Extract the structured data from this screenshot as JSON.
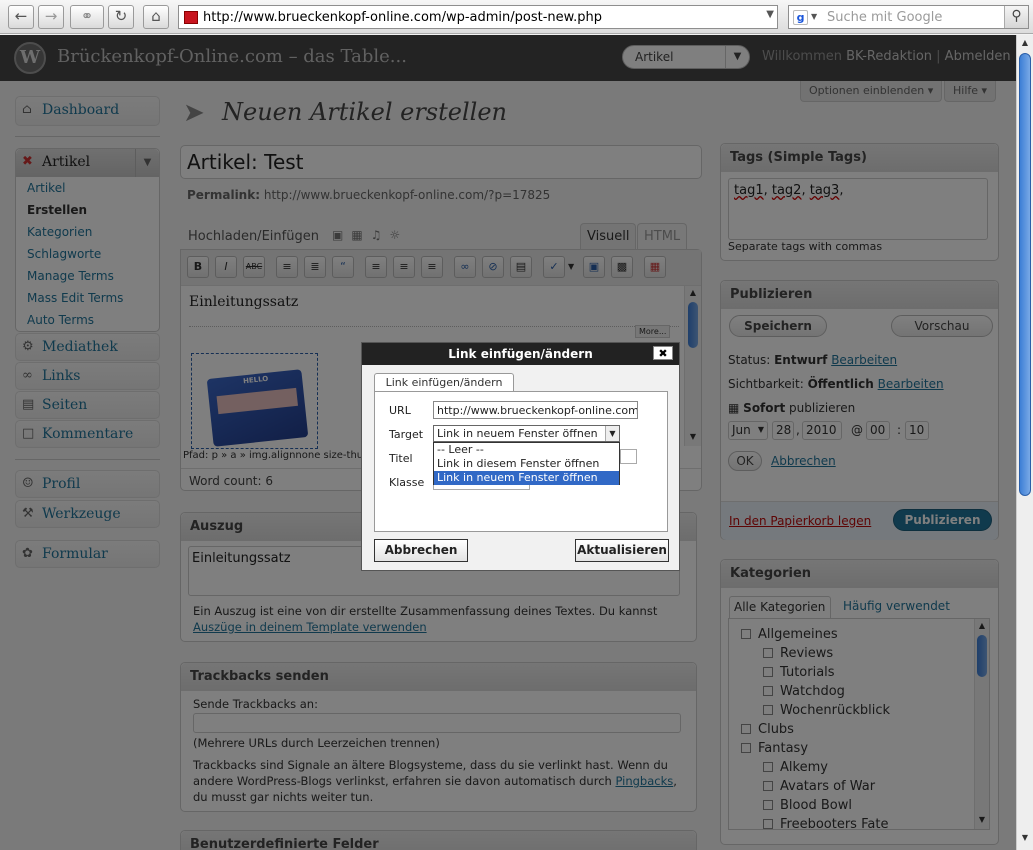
{
  "browser": {
    "url": "http://www.brueckenkopf-online.com/wp-admin/post-new.php",
    "search_placeholder": "Suche mit Google"
  },
  "header": {
    "site_title": "Brückenkopf-Online.com – das Table...",
    "favorites_selected": "Artikel",
    "welcome": "Willkommen",
    "username": "BK-Redaktion",
    "logout": "Abmelden"
  },
  "screen_options": {
    "options": "Optionen einblenden",
    "help": "Hilfe"
  },
  "sidebar": {
    "dashboard": "Dashboard",
    "artikel": "Artikel",
    "artikel_items": [
      "Artikel",
      "Erstellen",
      "Kategorien",
      "Schlagworte",
      "Manage Terms",
      "Mass Edit Terms",
      "Auto Terms"
    ],
    "mediathek": "Mediathek",
    "links": "Links",
    "seiten": "Seiten",
    "kommentare": "Kommentare",
    "profil": "Profil",
    "werkzeuge": "Werkzeuge",
    "formular": "Formular"
  },
  "main": {
    "page_title": "Neuen Artikel erstellen",
    "post_title": "Artikel: Test",
    "permalink_label": "Permalink:",
    "permalink_url": "http://www.brueckenkopf-online.com/?p=17825",
    "upload_label": "Hochladen/Einfügen",
    "tab_visual": "Visuell",
    "tab_html": "HTML",
    "editor_text": "Einleitungssatz",
    "more_tag": "More...",
    "image_text": "HELLO",
    "path": "Pfad: p » a » img.alignnone size-thumb",
    "word_count": "Word count: 6"
  },
  "excerpt": {
    "title": "Auszug",
    "value": "Einleitungssatz",
    "desc": "Ein Auszug ist eine von dir erstellte Zusammenfassung deines Textes. Du kannst",
    "link": "Auszüge in deinem Template verwenden"
  },
  "trackbacks": {
    "title": "Trackbacks senden",
    "label": "Sende Trackbacks an:",
    "hint": "(Mehrere URLs durch Leerzeichen trennen)",
    "desc1": "Trackbacks sind Signale an ältere Blogsysteme, dass du sie verlinkt hast. Wenn du",
    "desc2": "andere WordPress-Blogs verlinkst, erfahren sie davon automatisch durch",
    "pingbacks": "Pingbacks",
    "desc3": "du musst gar nichts weiter tun."
  },
  "custom_fields": {
    "title": "Benutzerdefinierte Felder"
  },
  "tags": {
    "title": "Tags (Simple Tags)",
    "value_parts": [
      "tag1",
      "tag2",
      "tag3"
    ],
    "hint": "Separate tags with commas"
  },
  "publish": {
    "title": "Publizieren",
    "save": "Speichern",
    "preview": "Vorschau",
    "status_label": "Status:",
    "status_value": "Entwurf",
    "edit": "Bearbeiten",
    "visibility_label": "Sichtbarkeit:",
    "visibility_value": "Öffentlich",
    "when": "Sofort",
    "when_suffix": "publizieren",
    "month": "Jun",
    "day": "28",
    "year": "2010",
    "hour": "00",
    "minute": "10",
    "ok": "OK",
    "cancel": "Abbrechen",
    "trash": "In den Papierkorb legen",
    "publish_btn": "Publizieren"
  },
  "categories": {
    "title": "Kategorien",
    "tab_all": "Alle Kategorien",
    "tab_used": "Häufig verwendet",
    "items": [
      {
        "label": "Allgemeines",
        "level": 0
      },
      {
        "label": "Reviews",
        "level": 1
      },
      {
        "label": "Tutorials",
        "level": 1
      },
      {
        "label": "Watchdog",
        "level": 1
      },
      {
        "label": "Wochenrückblick",
        "level": 1
      },
      {
        "label": "Clubs",
        "level": 0
      },
      {
        "label": "Fantasy",
        "level": 0
      },
      {
        "label": "Alkemy",
        "level": 1
      },
      {
        "label": "Avatars of War",
        "level": 1
      },
      {
        "label": "Blood Bowl",
        "level": 1
      },
      {
        "label": "Freebooters Fate",
        "level": 1
      }
    ]
  },
  "dialog": {
    "title": "Link einfügen/ändern",
    "tab": "Link einfügen/ändern",
    "url_label": "URL",
    "url_value": "http://www.brueckenkopf-online.com",
    "target_label": "Target",
    "target_value": "Link in neuem Fenster öffnen",
    "title_label": "Titel",
    "class_label": "Klasse",
    "target_options": [
      "-- Leer --",
      "Link in diesem Fenster öffnen",
      "Link in neuem Fenster öffnen"
    ],
    "cancel": "Abbrechen",
    "update": "Aktualisieren"
  },
  "colors": {
    "link": "#21759b",
    "header_bg": "#464646",
    "publish_btn": "#21759b",
    "trash": "#bc0b0b"
  }
}
